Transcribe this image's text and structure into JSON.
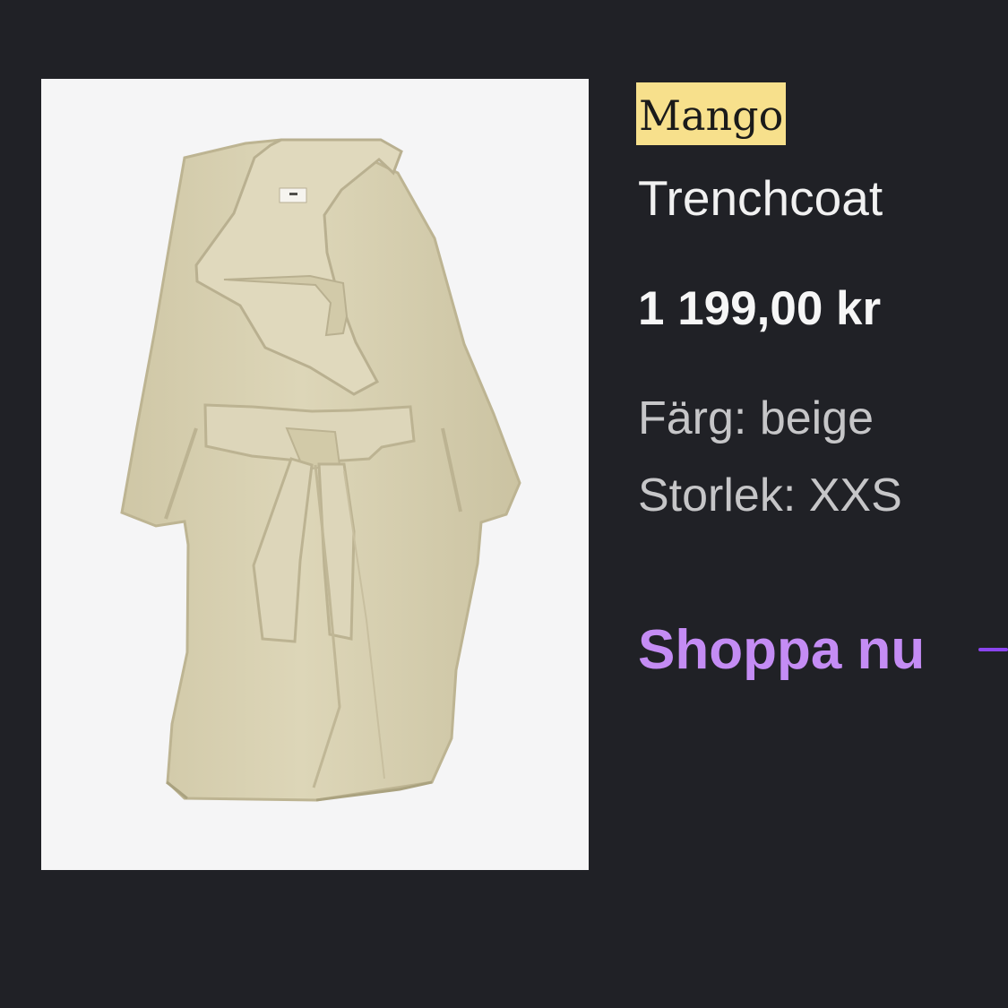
{
  "product": {
    "brand": "Mango",
    "name": "Trenchcoat",
    "price": "1 199,00 kr",
    "color_text": "Färg: beige",
    "size_text": "Storlek: XXS",
    "cta": "Shoppa nu"
  },
  "colors": {
    "background": "#202126",
    "image_background": "#f5f5f6",
    "brand_highlight": "#f7e08c",
    "cta": "#c48cf4",
    "arrow": "#8b45ef",
    "coat": "#d6cfae"
  },
  "icons": {
    "cta_arrow": "arrow-right-icon"
  }
}
